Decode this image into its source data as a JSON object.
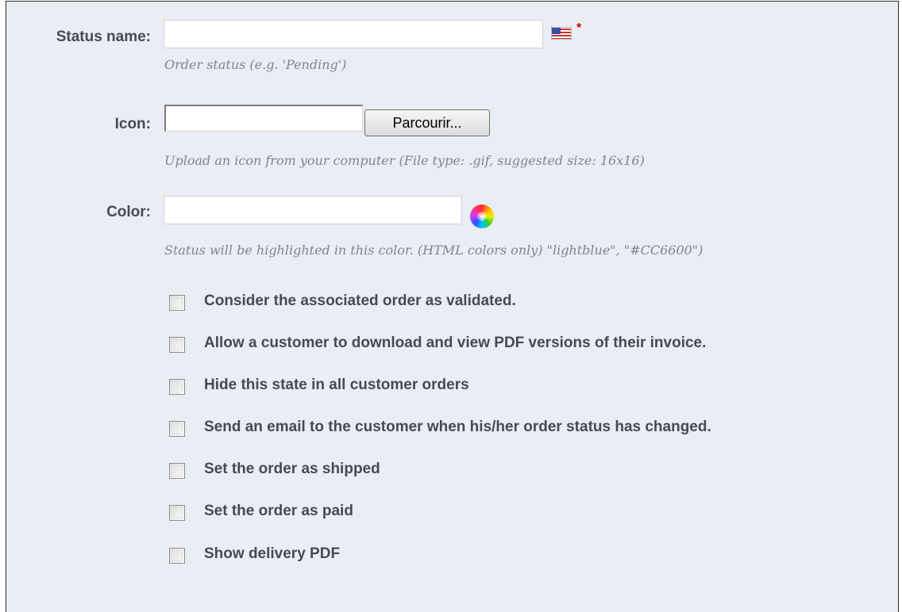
{
  "status_name": {
    "label": "Status name:",
    "value": "",
    "hint": "Order status (e.g. 'Pending')",
    "required_mark": "*",
    "language_icon": "us-flag-icon"
  },
  "icon": {
    "label": "Icon:",
    "file_value": "",
    "browse_label": "Parcourir...",
    "hint": "Upload an icon from your computer (File type: .gif, suggested size: 16x16)"
  },
  "color": {
    "label": "Color:",
    "value": "",
    "picker_icon": "color-wheel-icon",
    "hint": "Status will be highlighted in this color. (HTML colors only) \"lightblue\", \"#CC6600\")"
  },
  "options": [
    {
      "label": "Consider the associated order as validated.",
      "checked": false
    },
    {
      "label": "Allow a customer to download and view PDF versions of their invoice.",
      "checked": false
    },
    {
      "label": "Hide this state in all customer orders",
      "checked": false
    },
    {
      "label": "Send an email to the customer when his/her order status has changed.",
      "checked": false
    },
    {
      "label": "Set the order as shipped",
      "checked": false
    },
    {
      "label": "Set the order as paid",
      "checked": false
    },
    {
      "label": "Show delivery PDF",
      "checked": false
    }
  ],
  "colors": {
    "panel_background": "#ebedf4",
    "label_text": "#454a55",
    "hint_text": "#7f8390",
    "required": "#cc0000"
  }
}
